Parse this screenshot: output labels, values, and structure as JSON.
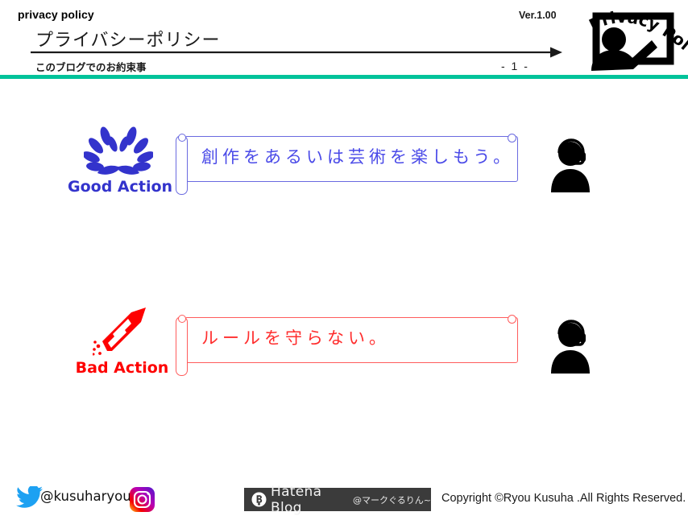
{
  "header": {
    "eyebrow": "privacy policy",
    "title": "プライバシーポリシー",
    "subtitle": "このブログでのお約束事",
    "version": "Ver.1.00",
    "page_number": "- 1 -",
    "badge_icon": "privacy-policy-presenter-icon",
    "badge_text": "Privacy Policy",
    "arrow_icon": "right-arrow-icon",
    "rule_color": "#00c39a"
  },
  "rows": [
    {
      "key": "good",
      "icon": "laurel-wreath-icon",
      "label": "Good Action",
      "color": "#3333cc",
      "message": "創作をあるいは芸術を楽しもう。",
      "message_color": "#4a4ae8",
      "scroll_border_color": "#6a6ae0",
      "person_icon": "person-with-headset-icon"
    },
    {
      "key": "bad",
      "icon": "firework-rocket-icon",
      "label": "Bad Action",
      "color": "#fe0000",
      "message": "ルールを守らない。",
      "message_color": "#ff2d2d",
      "scroll_border_color": "#ff5c5c",
      "person_icon": "person-with-headset-icon"
    }
  ],
  "footer": {
    "twitter_icon": "twitter-bird-icon",
    "twitter_handle": "@kusuharyou",
    "twitter_color": "#1da1f2",
    "instagram_icon": "instagram-camera-icon",
    "hatena_logo_icon": "hatena-b-mark-icon",
    "hatena_label": "Hatena Blog",
    "hatena_account": "@マークぐるりん~",
    "hatena_badge_color": "#3b3b3b",
    "copyright": "Copyright ©Ryou Kusuha .All Rights Reserved."
  }
}
